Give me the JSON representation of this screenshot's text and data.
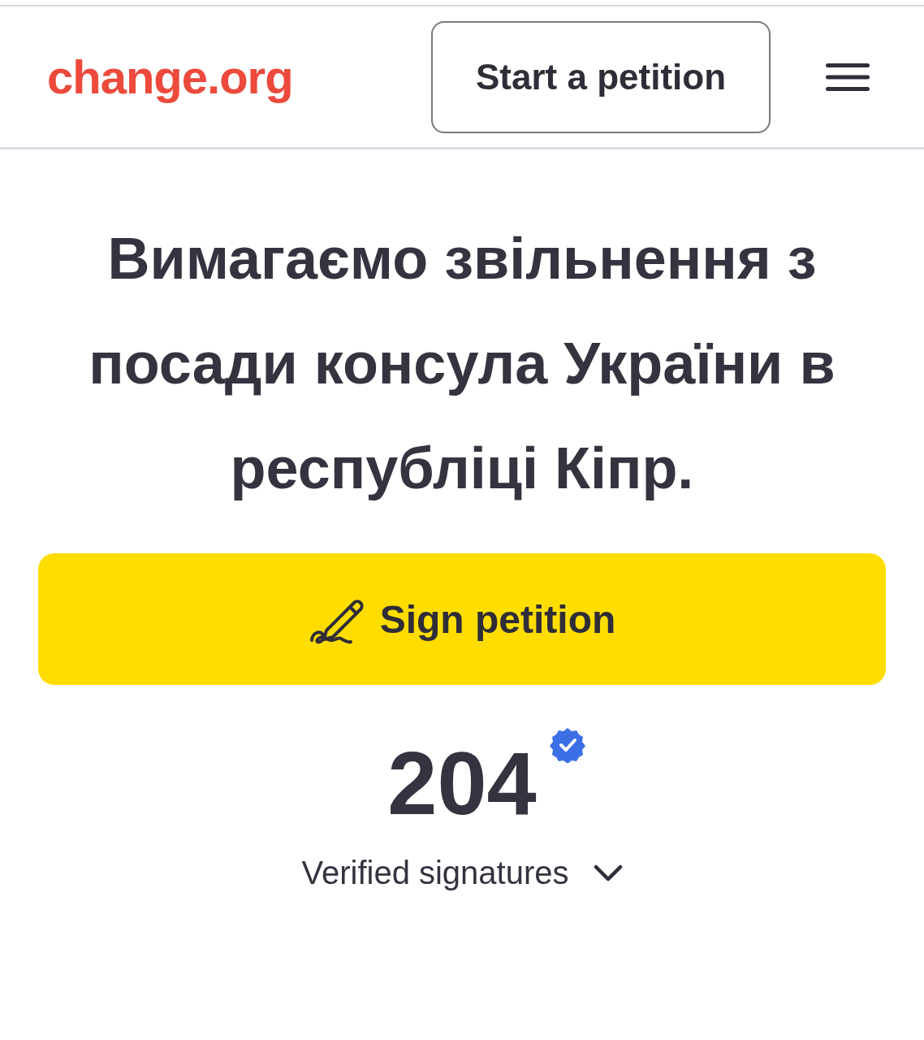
{
  "header": {
    "logo": "change.org",
    "start_button": "Start a petition"
  },
  "petition": {
    "title": "Вимагаємо звільнення з посади консула України в республіці Кіпр.",
    "sign_button": "Sign petition",
    "signature_count": "204",
    "signatures_label": "Verified signatures"
  }
}
